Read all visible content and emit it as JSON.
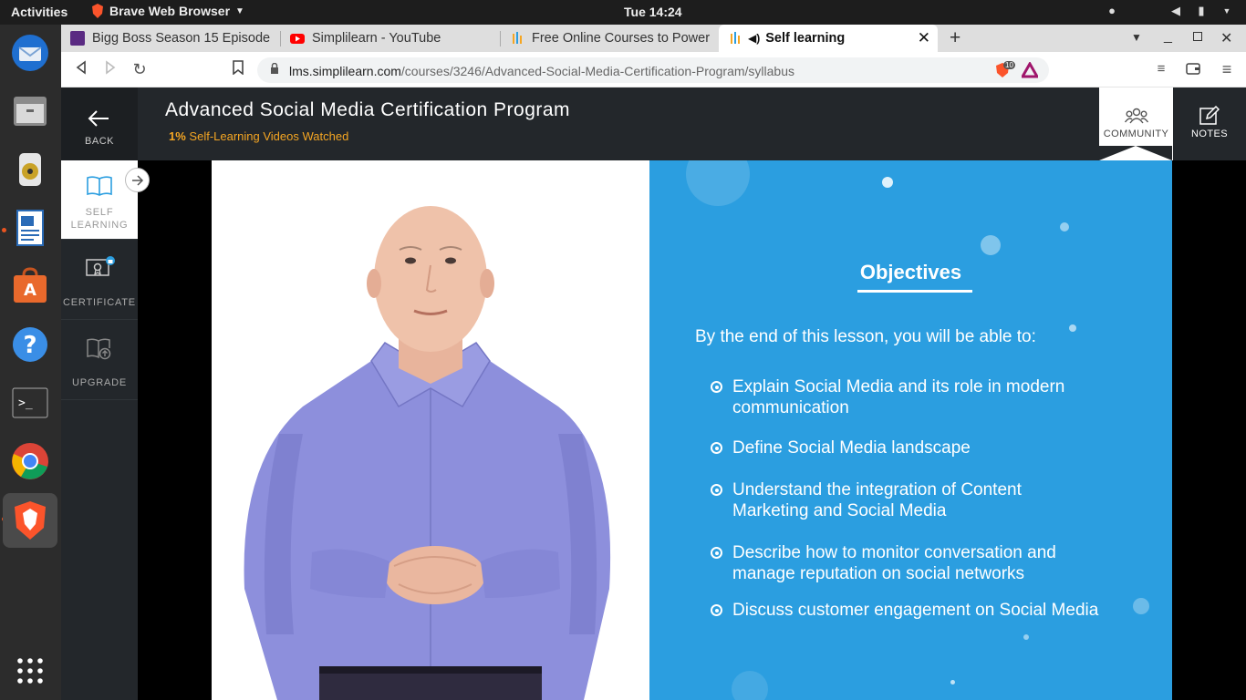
{
  "system": {
    "activities": "Activities",
    "app_name": "Brave Web Browser",
    "clock": "Tue 14:24"
  },
  "dock": {
    "items": [
      "thunderbird-icon",
      "files-icon",
      "rhythmbox-icon",
      "writer-icon",
      "software-center-icon",
      "help-icon",
      "terminal-icon",
      "chrome-icon",
      "brave-icon",
      "app-grid-icon"
    ]
  },
  "tabs": [
    {
      "title": "Bigg Boss Season 15 Episode",
      "favicon": "voot-icon"
    },
    {
      "title": "Simplilearn - YouTube",
      "favicon": "youtube-icon"
    },
    {
      "title": "Free Online Courses to Power",
      "favicon": "simplilearn-icon"
    },
    {
      "title": "Self learning",
      "favicon": "simplilearn-icon",
      "active": true
    }
  ],
  "address": {
    "host": "lms.simplilearn.com",
    "path": "/courses/3246/Advanced-Social-Media-Certification-Program/syllabus",
    "shields_count": "10"
  },
  "course": {
    "back_label": "BACK",
    "title": "Advanced Social Media Certification Program",
    "progress_pct": "1%",
    "progress_text": "Self-Learning Videos Watched",
    "community_label": "COMMUNITY",
    "notes_label": "NOTES"
  },
  "sidebar": {
    "items": [
      {
        "label_1": "SELF",
        "label_2": "LEARNING"
      },
      {
        "label": "CERTIFICATE"
      },
      {
        "label": "UPGRADE"
      }
    ]
  },
  "slide": {
    "title": "Objectives",
    "intro": "By the end of this lesson, you will be able to:",
    "objectives": [
      "Explain Social Media and its role in modern communication",
      "Define Social Media landscape",
      "Understand the integration of Content Marketing and Social Media",
      "Describe how to monitor conversation and manage reputation on social networks",
      "Discuss customer engagement on Social Media"
    ]
  },
  "colors": {
    "accent_orange": "#f5a623",
    "slide_blue": "#2b9ee0",
    "header_dark": "#23272b"
  }
}
